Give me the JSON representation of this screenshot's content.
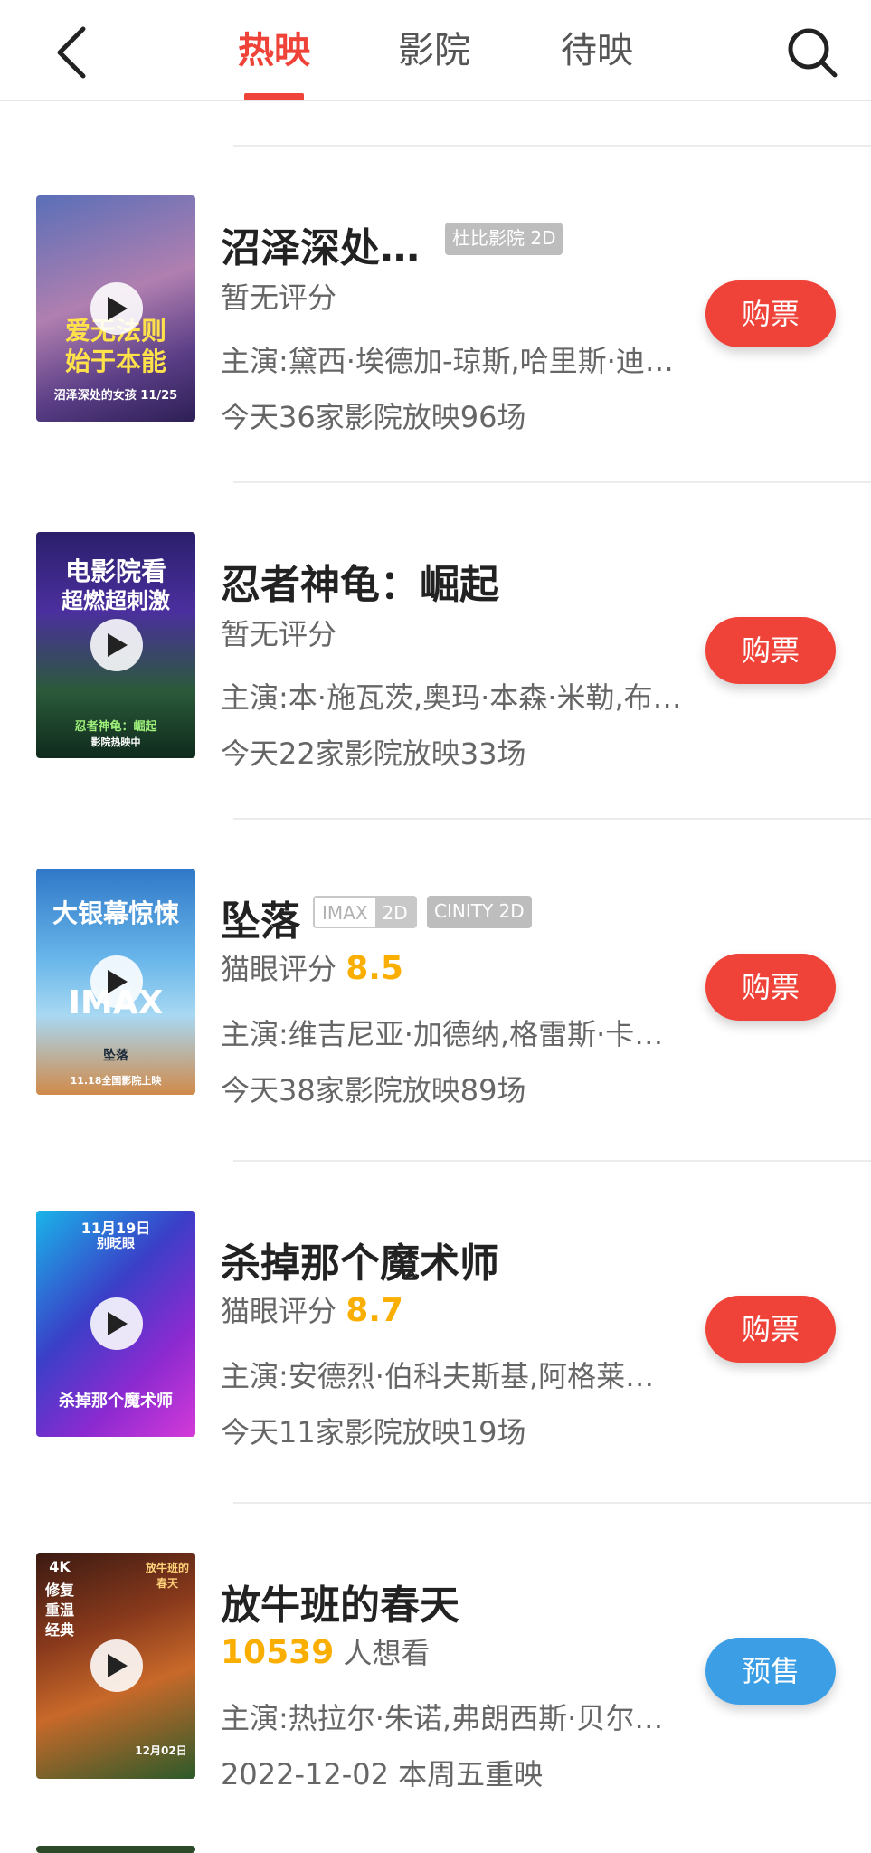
{
  "header": {
    "tabs": [
      {
        "label": "热映",
        "active": true
      },
      {
        "label": "影院",
        "active": false
      },
      {
        "label": "待映",
        "active": false
      }
    ],
    "accent_color": "#ef4238"
  },
  "movies": [
    {
      "title": "沼泽深处…",
      "tags": [
        "杜比影院 2D"
      ],
      "rating_line": "暂无评分",
      "cast": "主演:黛西·埃德加-琼斯,哈里斯·迪…",
      "schedule": "今天36家影院放映96场",
      "button": "购票",
      "poster_text": [
        "爱无法则",
        "始于本能",
        "沼泽深处的女孩 11/25"
      ]
    },
    {
      "title": "忍者神龟：崛起",
      "tags": [],
      "rating_line": "暂无评分",
      "cast": "主演:本·施瓦茨,奥玛·本森·米勒,布…",
      "schedule": "今天22家影院放映33场",
      "button": "购票",
      "poster_text": [
        "电影院看",
        "超燃超刺激",
        "忍者神龟：崛起",
        "影院热映中"
      ]
    },
    {
      "title": "坠落",
      "tags": [
        "IMAX",
        "2D",
        "CINITY 2D"
      ],
      "rating_prefix": "猫眼评分",
      "rating_score": "8.5",
      "cast": "主演:维吉尼亚·加德纳,格雷斯·卡…",
      "schedule": "今天38家影院放映89场",
      "button": "购票",
      "poster_text": [
        "大银幕惊悚",
        "IMAX",
        "坠落",
        "11.18全国影院上映"
      ]
    },
    {
      "title": "杀掉那个魔术师",
      "tags": [],
      "rating_prefix": "猫眼评分",
      "rating_score": "8.7",
      "cast": "主演:安德烈·伯科夫斯基,阿格莱…",
      "schedule": "今天11家影院放映19场",
      "button": "购票",
      "poster_text": [
        "11月19日",
        "别眨眼",
        "杀掉那个魔术师"
      ]
    },
    {
      "title": "放牛班的春天",
      "tags": [],
      "want_count": "10539",
      "want_suffix": "人想看",
      "cast": "主演:热拉尔·朱诺,弗朗西斯·贝尔…",
      "schedule": "2022-12-02 本周五重映",
      "button": "预售",
      "poster_text": [
        "4K",
        "修复",
        "重温",
        "经典",
        "放牛班的春天",
        "12月02日"
      ]
    }
  ],
  "button_colors": {
    "buy": "#ef4238",
    "presale": "#3c9fe6"
  },
  "score_color": "#faaf00"
}
